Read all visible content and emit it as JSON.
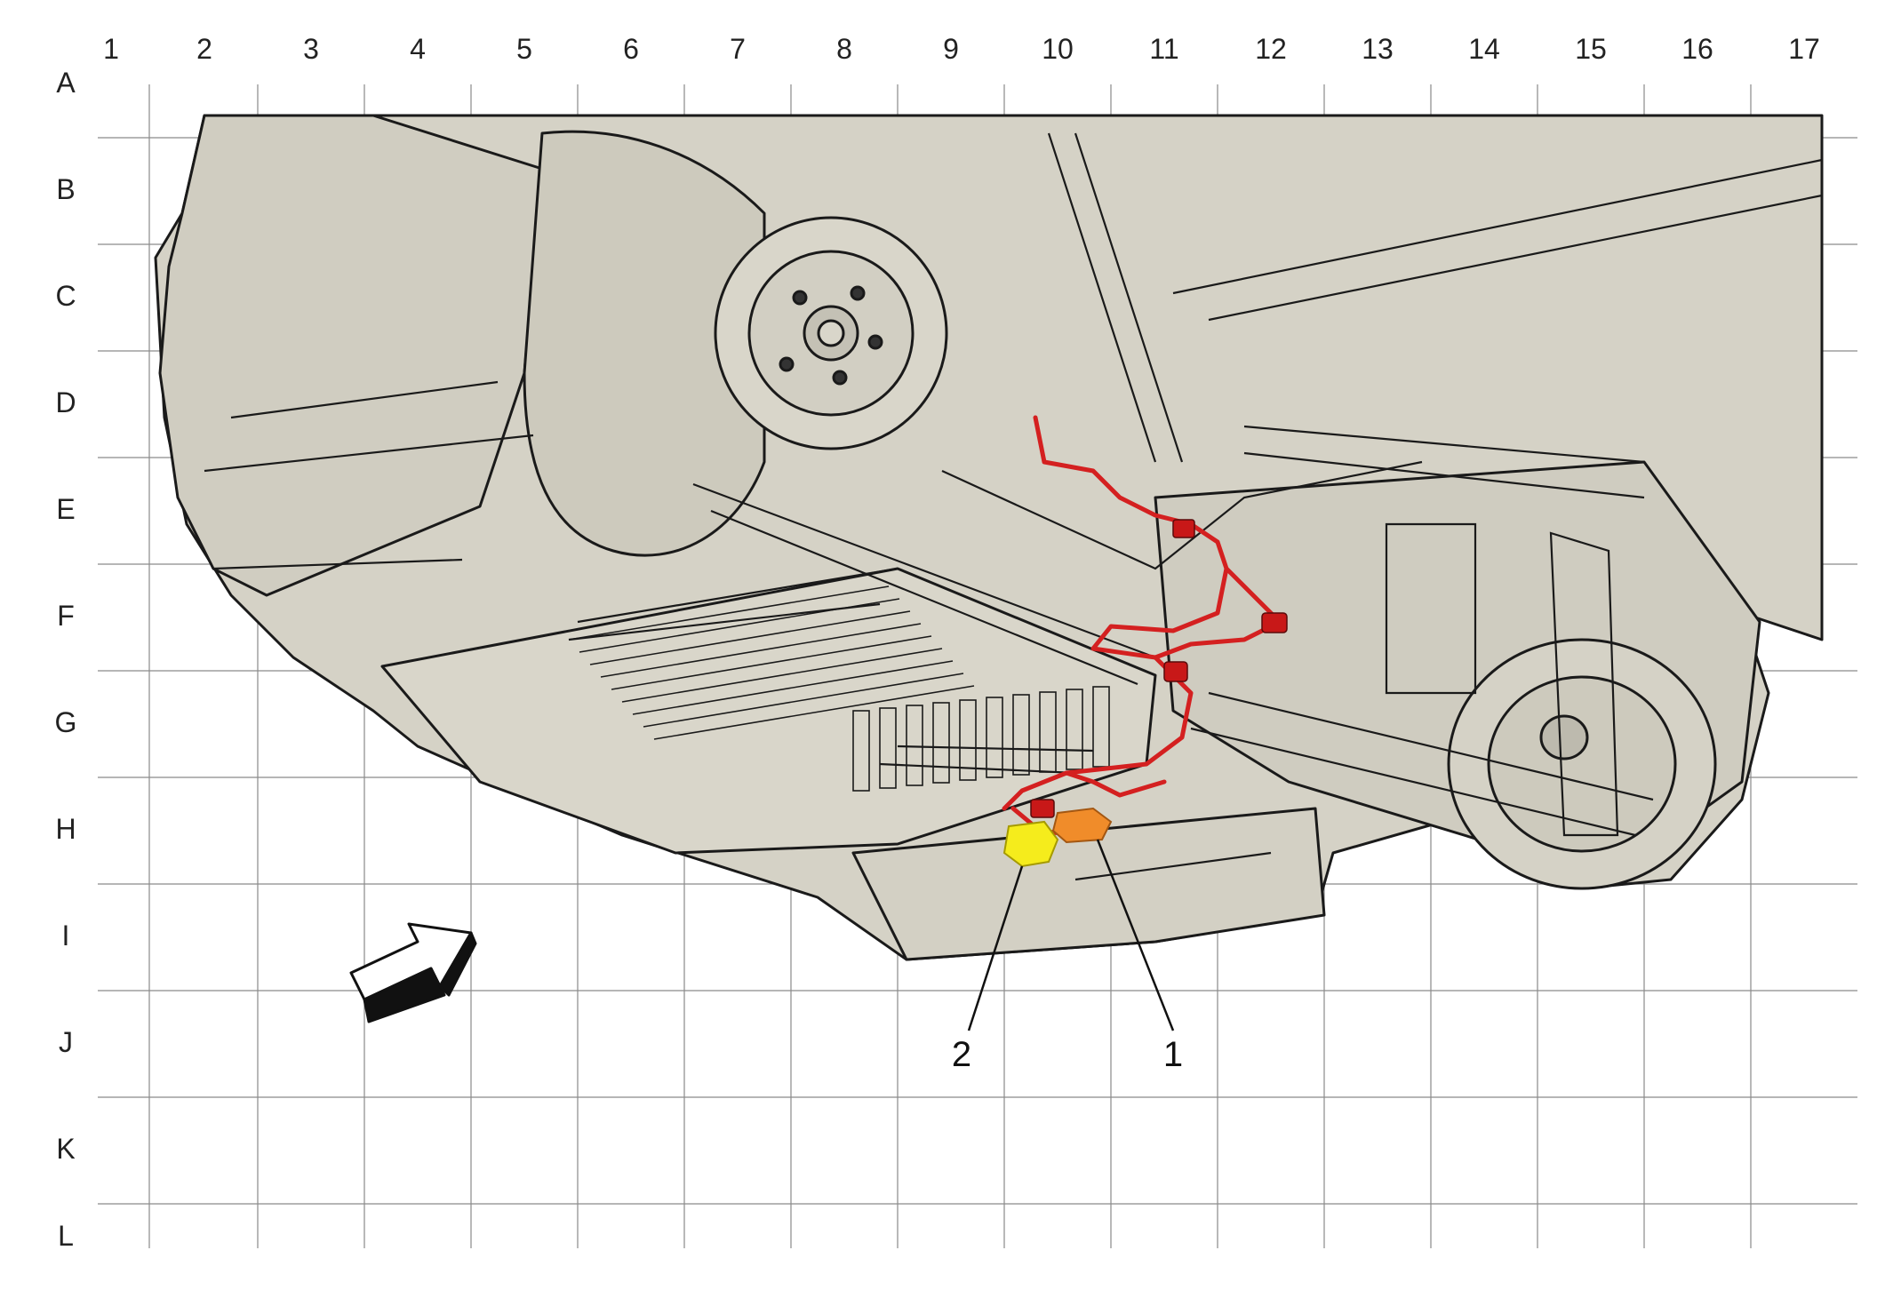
{
  "grid": {
    "columns": [
      "1",
      "2",
      "3",
      "4",
      "5",
      "6",
      "7",
      "8",
      "9",
      "10",
      "11",
      "12",
      "13",
      "14",
      "15",
      "16",
      "17"
    ],
    "rows": [
      "A",
      "B",
      "C",
      "D",
      "E",
      "F",
      "G",
      "H",
      "I",
      "J",
      "K",
      "L"
    ]
  },
  "callouts": [
    {
      "label": "1",
      "color": "#f08c2a"
    },
    {
      "label": "2",
      "color": "#f5ec1c"
    }
  ],
  "colors": {
    "body_fill": "#d5d2c6",
    "outline": "#1a1a1a",
    "harness": "#d42020",
    "grid_line": "#888888"
  },
  "icons": [
    "front-direction-arrow-icon"
  ]
}
